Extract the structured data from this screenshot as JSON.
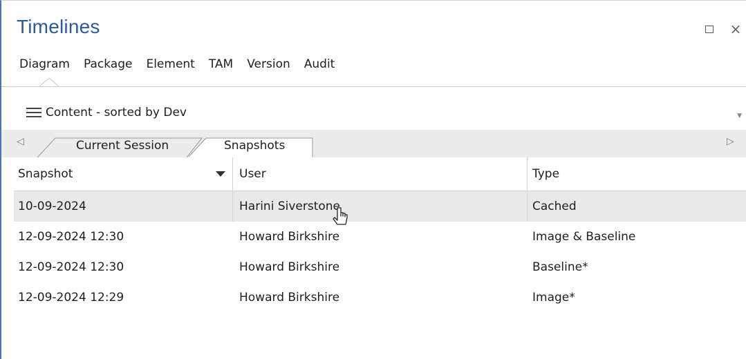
{
  "window": {
    "title": "Timelines",
    "restore_icon": "restore-icon",
    "close_label": "×"
  },
  "menu": {
    "items": [
      "Diagram",
      "Package",
      "Element",
      "TAM",
      "Version",
      "Audit"
    ]
  },
  "content_filter": {
    "label": "Content - sorted by Dev",
    "icon": "hamburger-icon"
  },
  "tabs": {
    "items": [
      {
        "label": "Current Session",
        "active": false
      },
      {
        "label": "Snapshots",
        "active": true
      }
    ],
    "left_arrow": "◁",
    "right_arrow": "▷"
  },
  "table": {
    "columns": [
      "Snapshot",
      "User",
      "Type"
    ],
    "sort_column": "Snapshot",
    "sort_direction": "descending",
    "rows": [
      {
        "snapshot": "10-09-2024",
        "user": "Harini Siverstone",
        "type": "Cached",
        "selected": true
      },
      {
        "snapshot": "12-09-2024 12:30",
        "user": "Howard Birkshire",
        "type": "Image & Baseline",
        "selected": false
      },
      {
        "snapshot": "12-09-2024 12:30",
        "user": "Howard Birkshire",
        "type": "Baseline*",
        "selected": false
      },
      {
        "snapshot": "12-09-2024 12:29",
        "user": "Howard Birkshire",
        "type": "Image*",
        "selected": false
      }
    ]
  },
  "colors": {
    "title": "#2c5aa0",
    "selected_row": "#e9e9e9",
    "window_border": "#4a73b8"
  }
}
